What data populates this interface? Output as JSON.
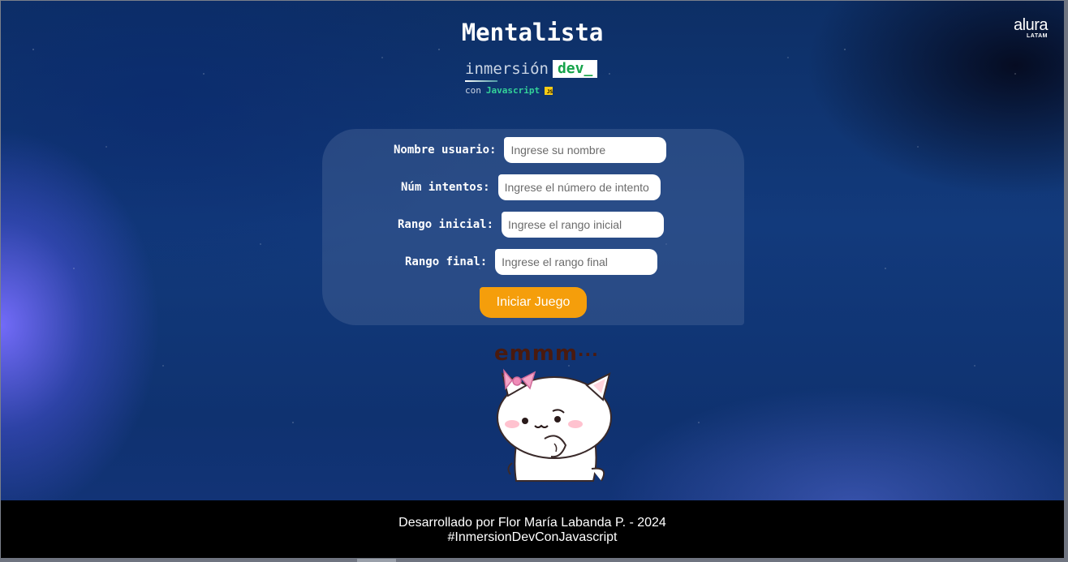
{
  "header": {
    "title": "Mentalista"
  },
  "brand": {
    "inmersion": "inmersión",
    "dev": "dev_",
    "con": "con",
    "javascript": "Javascript",
    "js_badge": "JS"
  },
  "alura": {
    "word": "alura",
    "sub": "LATAM"
  },
  "form": {
    "username_label": "Nombre usuario:",
    "username_placeholder": "Ingrese su nombre",
    "attempts_label": "Núm intentos:",
    "attempts_placeholder": "Ingrese el número de intento",
    "range_start_label": "Rango inicial:",
    "range_start_placeholder": "Ingrese el rango inicial",
    "range_end_label": "Rango final:",
    "range_end_placeholder": "Ingrese el rango final",
    "start_button": "Iniciar Juego"
  },
  "sticker": {
    "text": "emmm",
    "dots": "···"
  },
  "footer": {
    "line1": "Desarrollado por Flor María Labanda P. - 2024",
    "line2": "#InmersionDevConJavascript"
  },
  "colors": {
    "accent": "#f59e0b",
    "background": "#123a7c",
    "footer": "#000000",
    "dev_green": "#16a34a"
  }
}
